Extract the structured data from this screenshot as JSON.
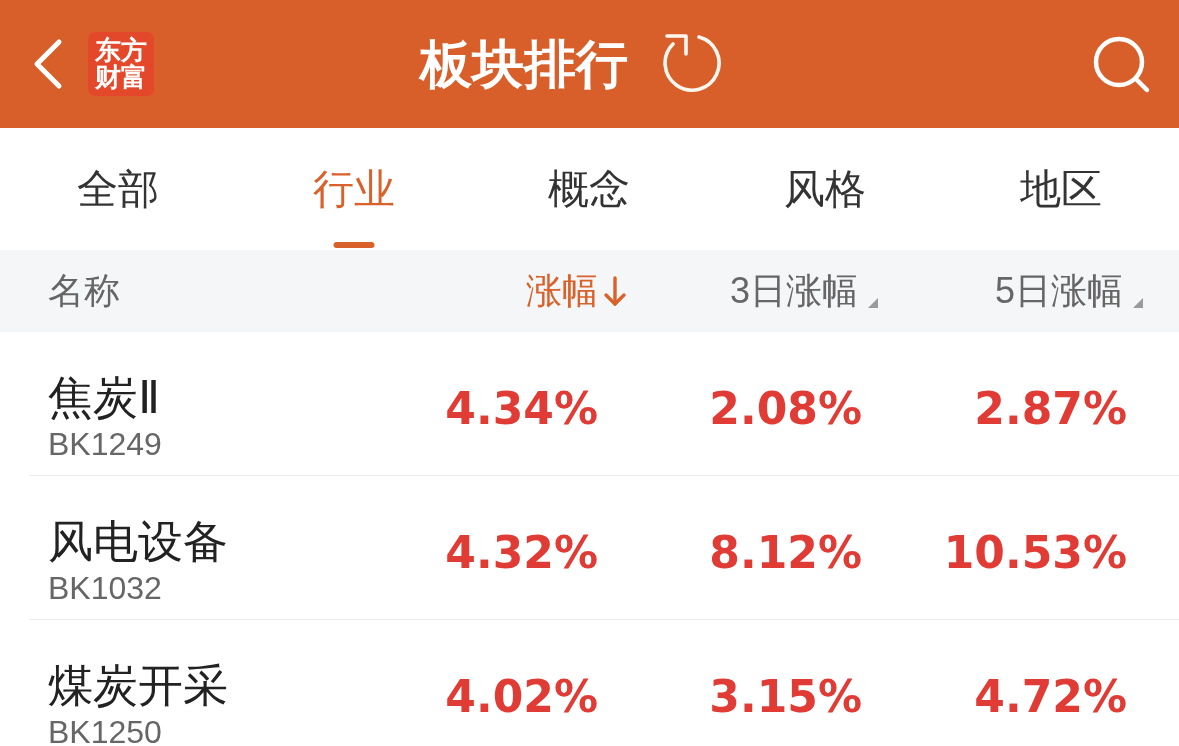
{
  "header": {
    "logo": "东方财富",
    "title": "板块排行"
  },
  "tabs": [
    {
      "label": "全部",
      "selected": false
    },
    {
      "label": "行业",
      "selected": true
    },
    {
      "label": "概念",
      "selected": false
    },
    {
      "label": "风格",
      "selected": false
    },
    {
      "label": "地区",
      "selected": false
    }
  ],
  "table": {
    "columns": [
      {
        "label": "名称",
        "kind": "label",
        "selected": false
      },
      {
        "label": "涨幅",
        "kind": "sort",
        "selected": true
      },
      {
        "label": "3日涨幅",
        "kind": "sort",
        "selected": false
      },
      {
        "label": "5日涨幅",
        "kind": "sort",
        "selected": false
      }
    ],
    "rows": [
      {
        "name": "焦炭Ⅱ",
        "code": "BK1249",
        "values": [
          "4.34%",
          "2.08%",
          "2.87%"
        ]
      },
      {
        "name": "风电设备",
        "code": "BK1032",
        "values": [
          "4.32%",
          "8.12%",
          "10.53%"
        ]
      },
      {
        "name": "煤炭开采",
        "code": "BK1250",
        "values": [
          "4.02%",
          "3.15%",
          "4.72%"
        ]
      }
    ]
  }
}
